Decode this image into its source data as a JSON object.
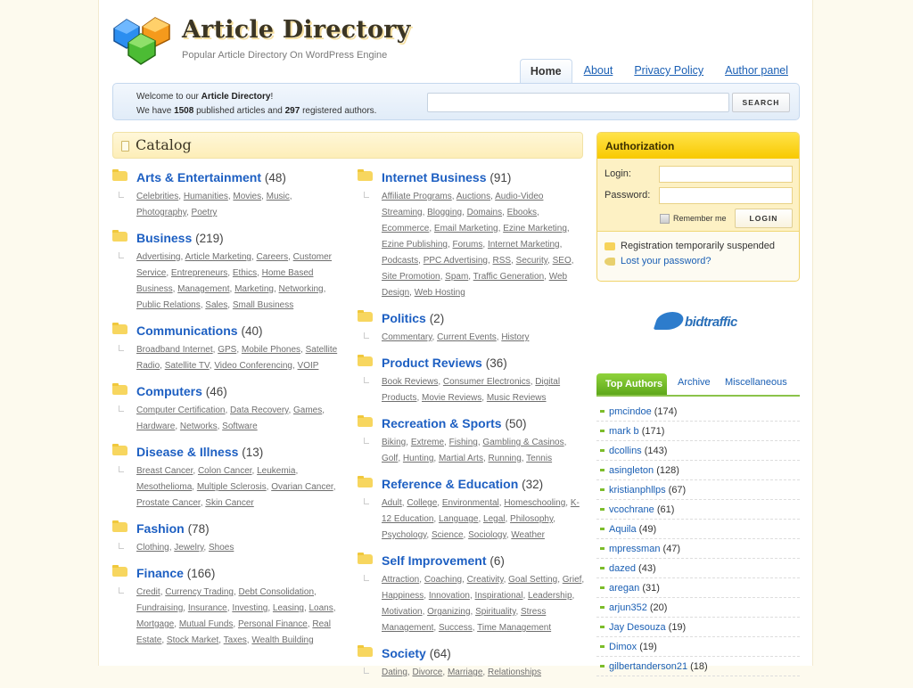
{
  "header": {
    "title": "Article Directory",
    "tagline": "Popular Article Directory On WordPress Engine"
  },
  "nav": {
    "tabs": [
      {
        "label": "Home",
        "active": true
      },
      {
        "label": "About"
      },
      {
        "label": "Privacy Policy"
      },
      {
        "label": "Author panel"
      }
    ]
  },
  "welcome": {
    "line1_prefix": "Welcome to our ",
    "line1_bold": "Article Directory",
    "line1_suffix": "!",
    "line2_prefix": "We have ",
    "articles": "1508",
    "line2_mid": " published articles and ",
    "authors": "297",
    "line2_suffix": " registered authors."
  },
  "search": {
    "value": "",
    "button_label": "SEARCH"
  },
  "catalog": {
    "title": "Catalog",
    "left": [
      {
        "name": "Arts & Entertainment",
        "count": "(48)",
        "subs": [
          "Celebrities",
          "Humanities",
          "Movies",
          "Music",
          "Photography",
          "Poetry"
        ]
      },
      {
        "name": "Business",
        "count": "(219)",
        "subs": [
          "Advertising",
          "Article Marketing",
          "Careers",
          "Customer Service",
          "Entrepreneurs",
          "Ethics",
          "Home Based Business",
          "Management",
          "Marketing",
          "Networking",
          "Public Relations",
          "Sales",
          "Small Business"
        ]
      },
      {
        "name": "Communications",
        "count": "(40)",
        "subs": [
          "Broadband Internet",
          "GPS",
          "Mobile Phones",
          "Satellite Radio",
          "Satellite TV",
          "Video Conferencing",
          "VOIP"
        ]
      },
      {
        "name": "Computers",
        "count": "(46)",
        "subs": [
          "Computer Certification",
          "Data Recovery",
          "Games",
          "Hardware",
          "Networks",
          "Software"
        ]
      },
      {
        "name": "Disease & Illness",
        "count": "(13)",
        "subs": [
          "Breast Cancer",
          "Colon Cancer",
          "Leukemia",
          "Mesothelioma",
          "Multiple Sclerosis",
          "Ovarian Cancer",
          "Prostate Cancer",
          "Skin Cancer"
        ]
      },
      {
        "name": "Fashion",
        "count": "(78)",
        "subs": [
          "Clothing",
          "Jewelry",
          "Shoes"
        ]
      },
      {
        "name": "Finance",
        "count": "(166)",
        "subs": [
          "Credit",
          "Currency Trading",
          "Debt Consolidation",
          "Fundraising",
          "Insurance",
          "Investing",
          "Leasing",
          "Loans",
          "Mortgage",
          "Mutual Funds",
          "Personal Finance",
          "Real Estate",
          "Stock Market",
          "Taxes",
          "Wealth Building"
        ]
      }
    ],
    "right": [
      {
        "name": "Internet Business",
        "count": "(91)",
        "subs": [
          "Affiliate Programs",
          "Auctions",
          "Audio-Video Streaming",
          "Blogging",
          "Domains",
          "Ebooks",
          "Ecommerce",
          "Email Marketing",
          "Ezine Marketing",
          "Ezine Publishing",
          "Forums",
          "Internet Marketing",
          "Podcasts",
          "PPC Advertising",
          "RSS",
          "Security",
          "SEO",
          "Site Promotion",
          "Spam",
          "Traffic Generation",
          "Web Design",
          "Web Hosting"
        ]
      },
      {
        "name": "Politics",
        "count": "(2)",
        "subs": [
          "Commentary",
          "Current Events",
          "History"
        ]
      },
      {
        "name": "Product Reviews",
        "count": "(36)",
        "subs": [
          "Book Reviews",
          "Consumer Electronics",
          "Digital Products",
          "Movie Reviews",
          "Music Reviews"
        ]
      },
      {
        "name": "Recreation & Sports",
        "count": "(50)",
        "subs": [
          "Biking",
          "Extreme",
          "Fishing",
          "Gambling & Casinos",
          "Golf",
          "Hunting",
          "Martial Arts",
          "Running",
          "Tennis"
        ]
      },
      {
        "name": "Reference & Education",
        "count": "(32)",
        "subs": [
          "Adult",
          "College",
          "Environmental",
          "Homeschooling",
          "K-12 Education",
          "Language",
          "Legal",
          "Philosophy",
          "Psychology",
          "Science",
          "Sociology",
          "Weather"
        ]
      },
      {
        "name": "Self Improvement",
        "count": "(6)",
        "subs": [
          "Attraction",
          "Coaching",
          "Creativity",
          "Goal Setting",
          "Grief",
          "Happiness",
          "Innovation",
          "Inspirational",
          "Leadership",
          "Motivation",
          "Organizing",
          "Spirituality",
          "Stress Management",
          "Success",
          "Time Management"
        ]
      },
      {
        "name": "Society",
        "count": "(64)",
        "subs": [
          "Dating",
          "Divorce",
          "Marriage",
          "Relationships"
        ]
      }
    ]
  },
  "auth": {
    "title": "Authorization",
    "login_label": "Login:",
    "password_label": "Password:",
    "login_value": "",
    "password_value": "",
    "remember_label": "Remember me",
    "remember_checked": false,
    "button_label": "LOGIN",
    "registration_note": "Registration temporarily suspended",
    "lost_password": "Lost your password?"
  },
  "sponsor": {
    "name": "bidtraffic"
  },
  "side_tabs": [
    {
      "label": "Top Authors",
      "active": true
    },
    {
      "label": "Archive"
    },
    {
      "label": "Miscellaneous"
    }
  ],
  "top_authors": [
    {
      "name": "pmcindoe",
      "count": "(174)"
    },
    {
      "name": "mark b",
      "count": "(171)"
    },
    {
      "name": "dcollins",
      "count": "(143)"
    },
    {
      "name": "asingleton",
      "count": "(128)"
    },
    {
      "name": "kristianphllps",
      "count": "(67)"
    },
    {
      "name": "vcochrane",
      "count": "(61)"
    },
    {
      "name": "Aquila",
      "count": "(49)"
    },
    {
      "name": "mpressman",
      "count": "(47)"
    },
    {
      "name": "dazed",
      "count": "(43)"
    },
    {
      "name": "aregan",
      "count": "(31)"
    },
    {
      "name": "arjun352",
      "count": "(20)"
    },
    {
      "name": "Jay Desouza",
      "count": "(19)"
    },
    {
      "name": "Dimox",
      "count": "(19)"
    },
    {
      "name": "gilbertanderson21",
      "count": "(18)"
    }
  ]
}
